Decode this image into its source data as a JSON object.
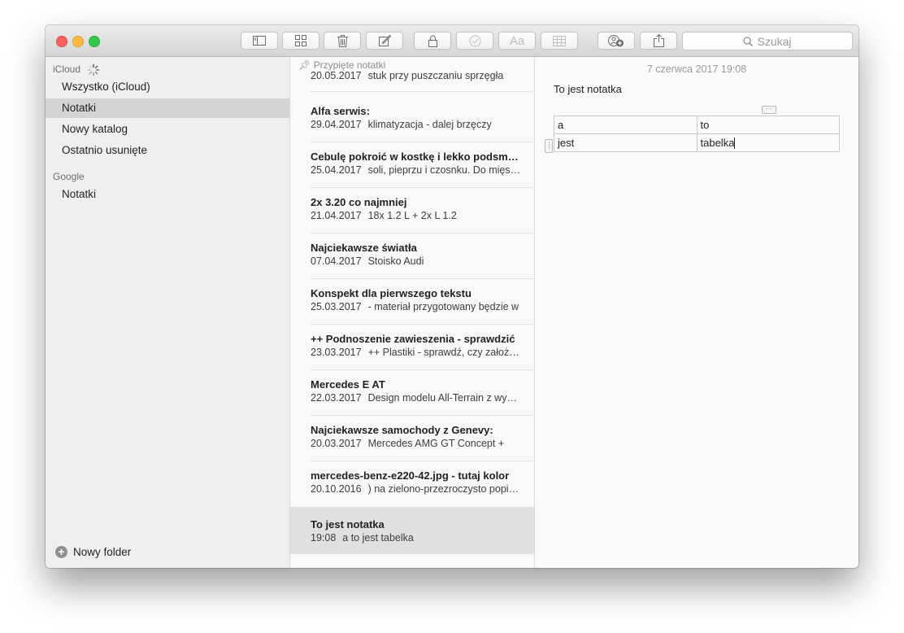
{
  "toolbar": {
    "buttons": [
      {
        "name": "toggle-sidebar-button",
        "icon": "sidebar-icon"
      },
      {
        "name": "attachments-button",
        "icon": "grid-icon"
      },
      {
        "name": "delete-button",
        "icon": "trash-icon"
      },
      {
        "name": "compose-button",
        "icon": "compose-icon"
      },
      {
        "name": "lock-button",
        "icon": "lock-icon"
      },
      {
        "name": "checklist-button",
        "icon": "checkmark-icon",
        "disabled": true
      },
      {
        "name": "format-button",
        "icon": "font-icon",
        "label": "Aa",
        "disabled": true
      },
      {
        "name": "table-button",
        "icon": "table-icon",
        "disabled": true
      },
      {
        "name": "add-people-button",
        "icon": "add-people-icon"
      },
      {
        "name": "share-button",
        "icon": "share-icon"
      }
    ],
    "search_placeholder": "Szukaj"
  },
  "sidebar": {
    "icloud_header": "iCloud",
    "icloud_items": [
      {
        "label": "Wszystko (iCloud)",
        "selected": false
      },
      {
        "label": "Notatki",
        "selected": true
      },
      {
        "label": "Nowy katalog",
        "selected": false
      },
      {
        "label": "Ostatnio usunięte",
        "selected": false
      }
    ],
    "google_header": "Google",
    "google_items": [
      {
        "label": "Notatki",
        "selected": false
      }
    ],
    "new_folder_label": "Nowy folder"
  },
  "notes": {
    "pinned_header": "Przypięte notatki",
    "items": [
      {
        "title": "",
        "date": "20.05.2017",
        "preview": "stuk przy puszczaniu sprzęgła"
      },
      {
        "title": "Alfa serwis:",
        "date": "29.04.2017",
        "preview": "klimatyzacja - dalej brzęczy"
      },
      {
        "title": "Cebulę pokroić w kostkę i lekko podsmażyć",
        "date": "25.04.2017",
        "preview": "soli, pieprzu i czosnku. Do mięsa dodać"
      },
      {
        "title": "2x 3.20 co najmniej",
        "date": "21.04.2017",
        "preview": "18x 1.2 L + 2x L 1.2"
      },
      {
        "title": "Najciekawsze światła",
        "date": "07.04.2017",
        "preview": "Stoisko Audi"
      },
      {
        "title": "Konspekt dla pierwszego tekstu",
        "date": "25.03.2017",
        "preview": "- materiał przygotowany będzie w"
      },
      {
        "title": "++ Podnoszenie zawieszenia - sprawdzić",
        "date": "23.03.2017",
        "preview": "++ Plastiki - sprawdź, czy założone"
      },
      {
        "title": "Mercedes E AT",
        "date": "22.03.2017",
        "preview": "Design modelu All-Terrain z wyglądu"
      },
      {
        "title": "Najciekawsze samochody z Genevy:",
        "date": "20.03.2017",
        "preview": "Mercedes AMG GT Concept +"
      },
      {
        "title": "mercedes-benz-e220-42.jpg - tutaj kolor",
        "date": "20.10.2016",
        "preview": ") na zielono-przezroczysto popielaty"
      },
      {
        "title": "To jest notatka",
        "date": "19:08",
        "preview": "a to jest tabelka",
        "selected": true
      }
    ]
  },
  "editor": {
    "date": "7 czerwca 2017 19:08",
    "body": "To jest notatka",
    "table": [
      [
        "a",
        "to"
      ],
      [
        "jest",
        "tabelka"
      ]
    ]
  }
}
